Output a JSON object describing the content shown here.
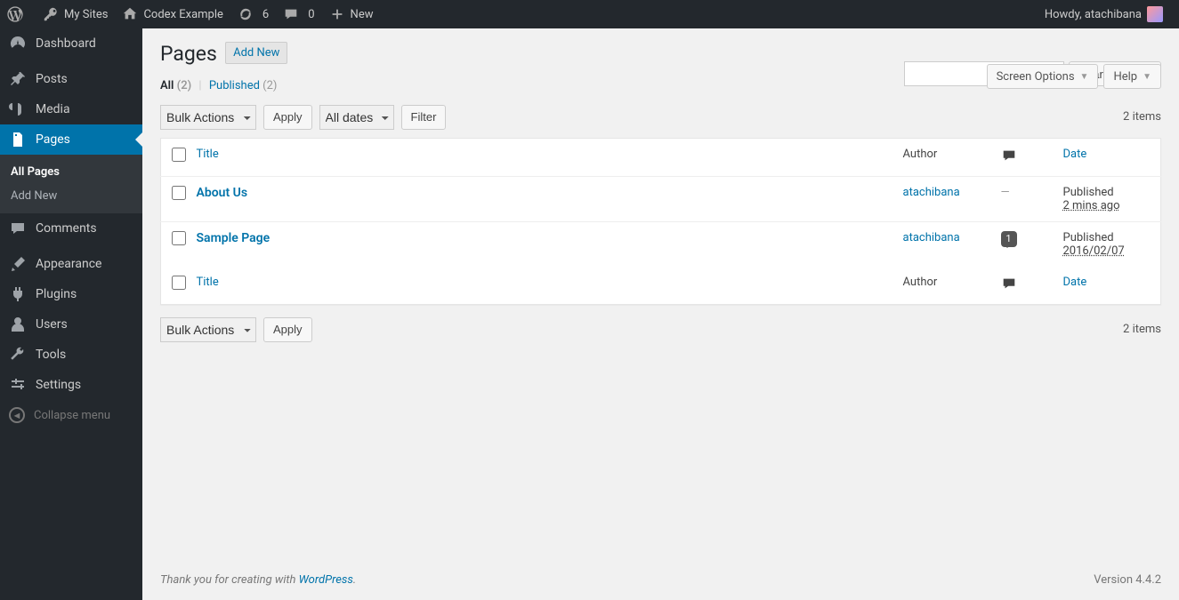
{
  "adminbar": {
    "mysites": "My Sites",
    "site": "Codex Example",
    "updates": "6",
    "comments": "0",
    "new": "New",
    "howdy": "Howdy, atachibana"
  },
  "sidebar": {
    "dashboard": "Dashboard",
    "posts": "Posts",
    "media": "Media",
    "pages": "Pages",
    "submenu": {
      "all": "All Pages",
      "add": "Add New"
    },
    "comments": "Comments",
    "appearance": "Appearance",
    "plugins": "Plugins",
    "users": "Users",
    "tools": "Tools",
    "settings": "Settings",
    "collapse": "Collapse menu"
  },
  "top": {
    "screen": "Screen Options",
    "help": "Help"
  },
  "page": {
    "title": "Pages",
    "addnew": "Add New",
    "filters": {
      "all": "All",
      "all_count": "(2)",
      "published": "Published",
      "published_count": "(2)"
    },
    "bulk": "Bulk Actions",
    "apply": "Apply",
    "alldates": "All dates",
    "filter": "Filter",
    "search": "Search Pages",
    "items": "2 items",
    "headers": {
      "title": "Title",
      "author": "Author",
      "date": "Date"
    },
    "rows": [
      {
        "title": "About Us",
        "author": "atachibana",
        "comments": "—",
        "status": "Published",
        "date": "2 mins ago"
      },
      {
        "title": "Sample Page",
        "author": "atachibana",
        "comments": "1",
        "status": "Published",
        "date": "2016/02/07"
      }
    ]
  },
  "footer": {
    "thanks": "Thank you for creating with ",
    "wp": "WordPress",
    "version": "Version 4.4.2"
  }
}
